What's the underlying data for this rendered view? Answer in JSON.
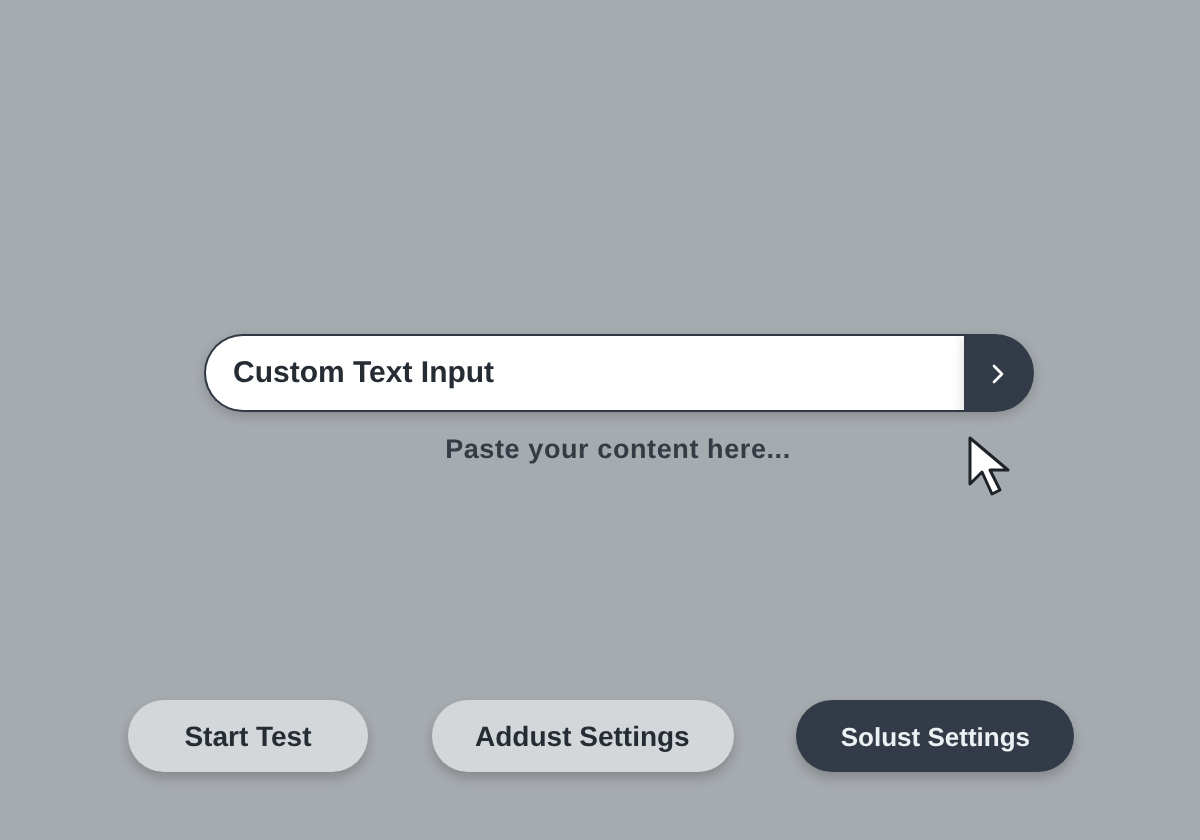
{
  "input": {
    "value": "Custom Text Input"
  },
  "helper_text": "Paste your content here...",
  "buttons": [
    {
      "label": "Start Test",
      "kind": "light"
    },
    {
      "label": "Addust Settings",
      "kind": "light"
    },
    {
      "label": "Solust Settings",
      "kind": "dark"
    }
  ]
}
